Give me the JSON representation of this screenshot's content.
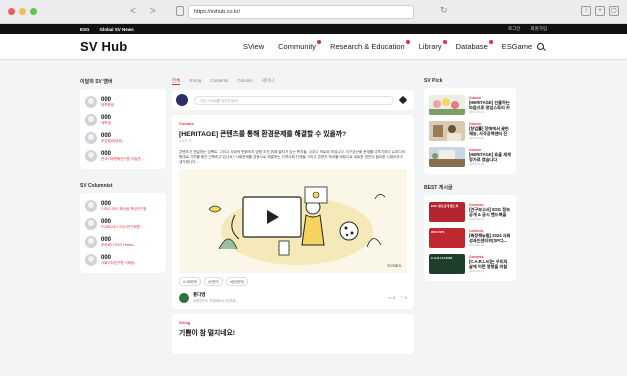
{
  "browser": {
    "url": "https://svhub.co.kr/"
  },
  "topbar": {
    "left": [
      "ESG",
      "Global SV News"
    ],
    "right": [
      "로그인",
      "회원가입"
    ]
  },
  "header": {
    "logo": "SV Hub",
    "nav": [
      {
        "label": "SView",
        "dot": false
      },
      {
        "label": "Community",
        "dot": true
      },
      {
        "label": "Research & Education",
        "dot": true
      },
      {
        "label": "Library",
        "dot": true
      },
      {
        "label": "Database",
        "dot": true
      },
      {
        "label": "ESGame",
        "dot": false
      }
    ]
  },
  "left": {
    "section1_title": "이달의 SV 멤버",
    "members": [
      {
        "name": "000",
        "sub": "대학원생"
      },
      {
        "name": "000",
        "sub": "대학생"
      },
      {
        "name": "000",
        "sub": "모임멤버(대표)"
      },
      {
        "name": "000",
        "sub": "한국기후변화연구원 무일연..."
      }
    ],
    "section2_title": "SV Columnist",
    "columnists": [
      {
        "name": "000",
        "sub": "CSES SPC 확산팀 책임연구원"
      },
      {
        "name": "000",
        "sub": "SV파트너스 ESG연구위원..."
      },
      {
        "name": "000",
        "sub": "모모회사 ESG Platfor..."
      },
      {
        "name": "000",
        "sub": "사회가치연구원 기획팀..."
      }
    ]
  },
  "center": {
    "tabs": [
      "전체",
      "SVlog",
      "Contents",
      "Column",
      "세미나"
    ],
    "compose_placeholder": "지금 SVlog를 남겨주세요!",
    "post1": {
      "category": "Column",
      "title": "[HERITAGE] 콘텐츠를 통해 환경문제를 해결할 수 있을까?",
      "date": "2시간 전",
      "body": "콘텐츠가 전달하는 임팩트, 그리고 사회적 변화까지 영향 조건 위해 출처가 있는 복지들, 너무나 의로워 보입니다. 지구온난화 문제를 다루기보다 뉴미디어 형태로 가치를 증진 선택하고 있나요? 사회문제를 공동으로 해결하는 지역사회 단체들 그리고 콘텐츠 에코를 바탕으로 새로운 방안이 필요한 시점이라고 생각합니다...",
      "image_credit": "©CSES",
      "tags": [
        "#사회문제",
        "#컨텐츠",
        "#환경문제"
      ],
      "author_name": "홍다영",
      "author_sub": "환경연구소 지정파트너 (인공위)",
      "comments": "8",
      "likes": "0"
    },
    "post2": {
      "category": "SVlog",
      "title": "기쁨이 참 멀지네요!"
    }
  },
  "right": {
    "pick_title": "SV Pick",
    "picks": [
      {
        "category": "Column",
        "title": "[HERITAGE] 선물하는 마음으로 창업스토리 카운 공정무역 꽃",
        "date": "2023.03.13"
      },
      {
        "category": "Column",
        "title": "[창업률] 장애에서 꽃핀 재능, 사각공백센터 진행하는 창가 ...",
        "date": "2023.03.20"
      },
      {
        "category": "Column",
        "title": "[HERITAGE] 호올 세계 정가로 였습니다",
        "date": "2023.02.15"
      }
    ],
    "best_title": "BEST 게시글",
    "best": [
      {
        "category": "Contents",
        "title": "[연구보고서] ESG 정보공개 & 공시 핸드북을 소개합니다.",
        "date": "2023.03.23",
        "thumb": "ESG 정보공개 핸드북"
      },
      {
        "category": "Contents",
        "title": "[축정책뉴필] 2024 사회성과인센티브(SPC)...",
        "date": "2023.03.23",
        "thumb": "2024 SPC"
      },
      {
        "category": "Contents",
        "title": "[C.A.R.I.AI]는 우리의 삶에 어떤 영향을 미칠까?",
        "date": "2023.03.23",
        "thumb": "C.A.R.I.AI 2023"
      }
    ]
  },
  "colors": {
    "accent": "#e0323e",
    "dark": "#111111"
  }
}
